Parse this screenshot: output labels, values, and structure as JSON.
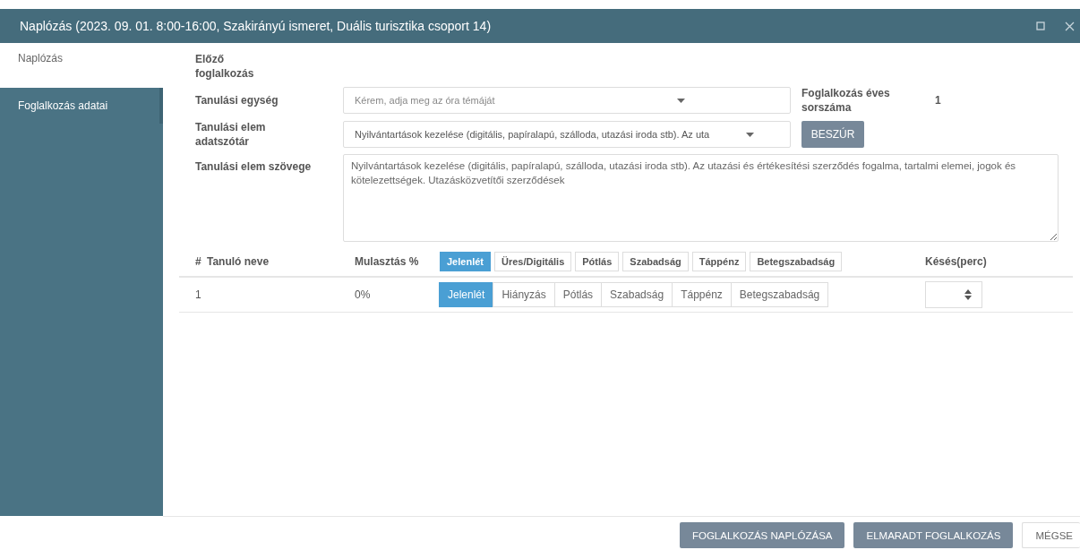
{
  "window": {
    "title": "Naplózás (2023. 09. 01. 8:00-16:00, Szakirányú ismeret, Duális turisztika csoport 14)"
  },
  "sidebar": {
    "items": [
      {
        "label": "Naplózás",
        "selected": true
      },
      {
        "label": "Foglalkozás adatai",
        "selected": false
      }
    ]
  },
  "form": {
    "previous_label": "Előző foglalkozás",
    "unit": {
      "label": "Tanulási egység",
      "placeholder": "Kérem, adja meg az óra témáját"
    },
    "element": {
      "label": "Tanulási elem adatszótár",
      "value": "Nyilvántartások kezelése (digitális, papíralapú, szálloda, utazási iroda stb). Az uta"
    },
    "annual": {
      "label": "Foglalkozás éves sorszáma",
      "value": "1"
    },
    "insert_button": "BESZÚR",
    "text": {
      "label": "Tanulási elem szövege",
      "value": "Nyilvántartások kezelése (digitális, papíralapú, szálloda, utazási iroda stb). Az utazási és értékesítési szerződés fogalma, tartalmi elemei, jogok és kötelezettségek. Utazásközvetítői szerződések"
    }
  },
  "table": {
    "columns": {
      "number": "#",
      "name": "Tanuló neve",
      "absence": "Mulasztás %",
      "late": "Késés(perc)"
    },
    "bulk_options": [
      {
        "label": "Jelenlét",
        "selected": true
      },
      {
        "label": "Üres/Digitális",
        "selected": false
      },
      {
        "label": "Pótlás",
        "selected": false
      },
      {
        "label": "Szabadság",
        "selected": false
      },
      {
        "label": "Táppénz",
        "selected": false
      },
      {
        "label": "Betegszabadság",
        "selected": false
      }
    ],
    "rows": [
      {
        "number": "1",
        "absence": "0%",
        "options": [
          {
            "label": "Jelenlét",
            "selected": true
          },
          {
            "label": "Hiányzás",
            "selected": false
          },
          {
            "label": "Pótlás",
            "selected": false
          },
          {
            "label": "Szabadság",
            "selected": false
          },
          {
            "label": "Táppénz",
            "selected": false
          },
          {
            "label": "Betegszabadság",
            "selected": false
          }
        ]
      }
    ]
  },
  "buttons": [
    {
      "label": "FOGLALKOZÁS NAPLÓZÁSA",
      "kind": "primary"
    },
    {
      "label": "ELMARADT FOGLALKOZÁS",
      "kind": "primary"
    },
    {
      "label": "MÉGSE",
      "kind": "plain"
    }
  ]
}
